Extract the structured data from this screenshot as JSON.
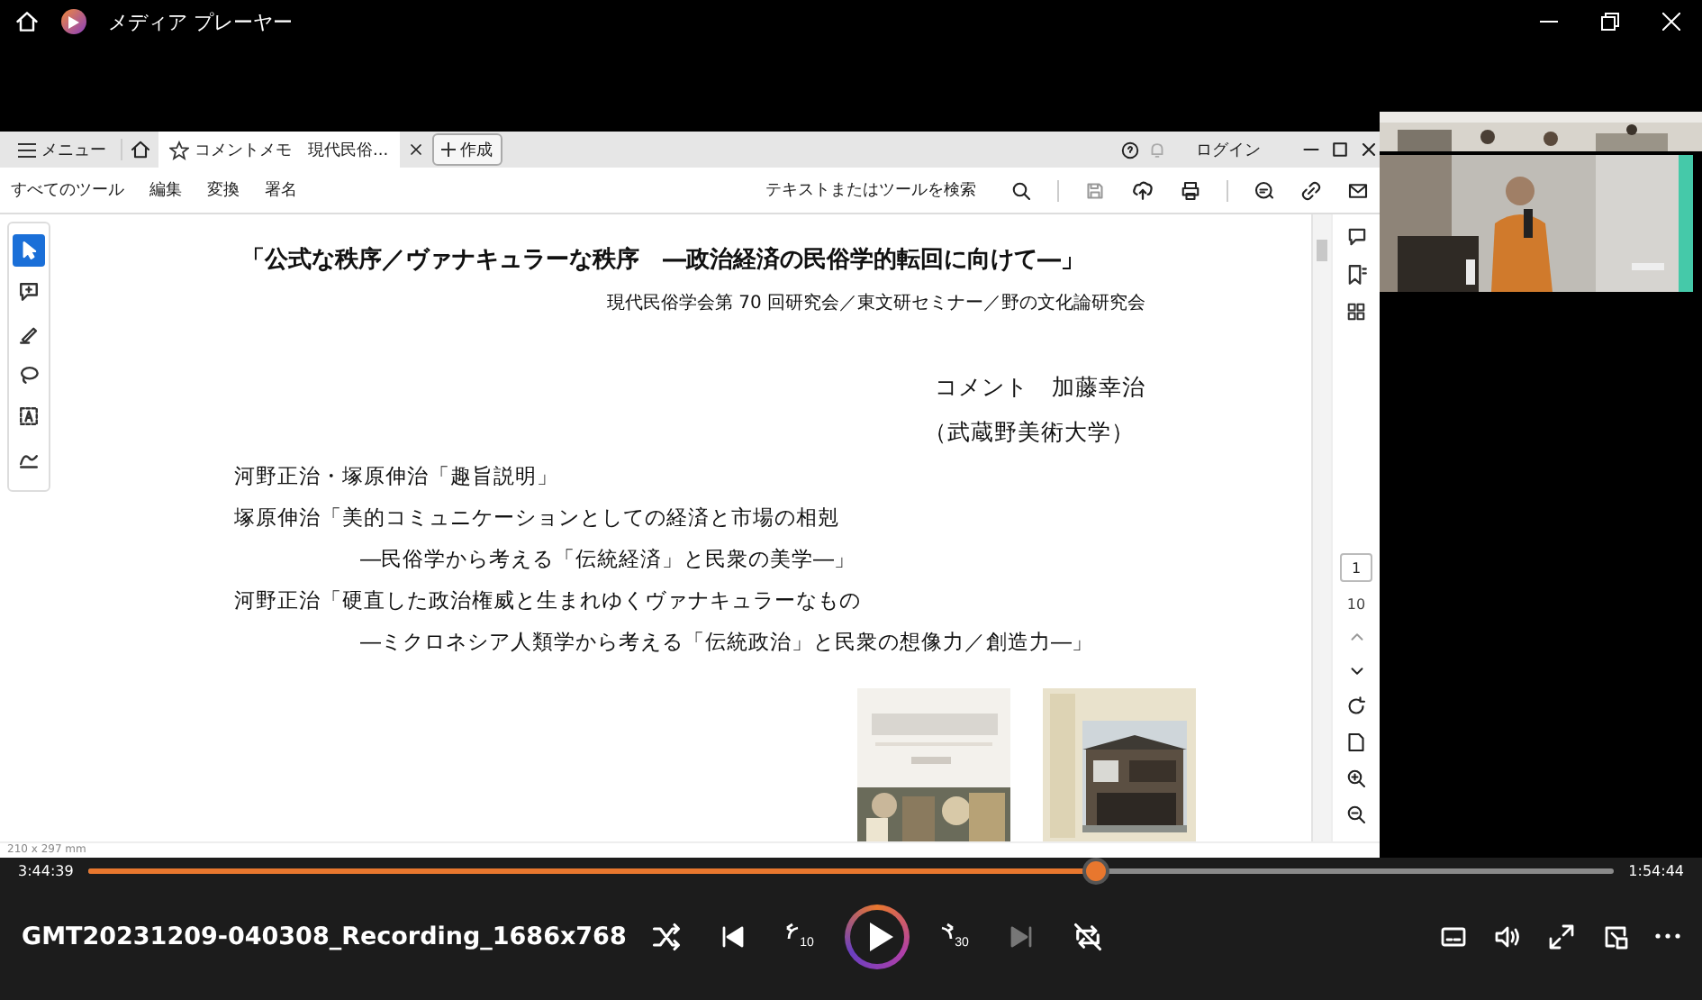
{
  "app": {
    "title": "メディア プレーヤー"
  },
  "viewer": {
    "menu": "メニュー",
    "tab": {
      "title": "コメントメモ　現代民俗...",
      "selected": true
    },
    "create": "作成",
    "login": "ログイン",
    "menus": [
      "すべてのツール",
      "編集",
      "変換",
      "署名"
    ],
    "search": {
      "placeholder": "テキストまたはツールを検索"
    },
    "tools": [
      {
        "kind": "select",
        "selected": true
      },
      {
        "kind": "comment",
        "selected": false
      },
      {
        "kind": "pen",
        "selected": false
      },
      {
        "kind": "lasso",
        "selected": false
      },
      {
        "kind": "textbox",
        "selected": false
      },
      {
        "kind": "sign",
        "selected": false
      }
    ],
    "page": {
      "current": "1",
      "total": "10"
    },
    "paper_size": "210 x 297 mm",
    "document": {
      "title": "「公式な秩序／ヴァナキュラーな秩序　―政治経済の民俗学的転回に向けて―」",
      "subtitle": "現代民俗学会第 70 回研究会／東文研セミナー／野の文化論研究会",
      "commenter": "コメント　加藤幸治",
      "affiliation": "（武蔵野美術大学）",
      "lines": [
        {
          "kind": "talk",
          "text": "河野正治・塚原伸治「趣旨説明」"
        },
        {
          "kind": "talk",
          "text": "塚原伸治「美的コミュニケーションとしての経済と市場の相剋"
        },
        {
          "kind": "sub",
          "text": "―民俗学から考える「伝統経済」と民衆の美学―」"
        },
        {
          "kind": "talk",
          "text": "河野正治「硬直した政治権威と生まれゆくヴァナキュラーなもの"
        },
        {
          "kind": "sub",
          "text": "―ミクロネシア人類学から考える「伝統政治」と民衆の想像力／創造力―」"
        }
      ]
    }
  },
  "player": {
    "elapsed": "3:44:39",
    "remaining": "1:54:44",
    "seek": {
      "level": 0.66
    },
    "file": "GMT20231209-040308_Recording_1686x768",
    "controls": [
      {
        "kind": "shuffle",
        "disabled": false
      },
      {
        "kind": "previous",
        "disabled": false
      },
      {
        "kind": "rewind",
        "label": "10",
        "disabled": false
      },
      {
        "kind": "play",
        "disabled": false
      },
      {
        "kind": "forward",
        "label": "30",
        "disabled": false
      },
      {
        "kind": "next",
        "disabled": true
      },
      {
        "kind": "repeat",
        "disabled": false
      }
    ]
  }
}
